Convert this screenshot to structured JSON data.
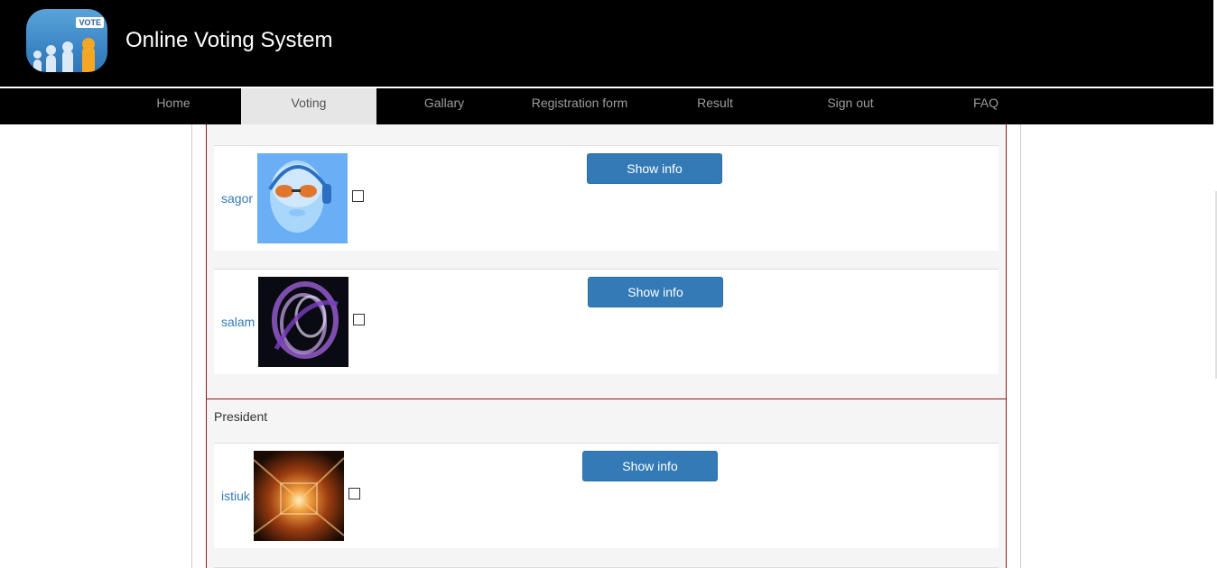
{
  "header": {
    "logo_tag": "VOTE",
    "title": "Online Voting System"
  },
  "nav": {
    "items": [
      {
        "label": "Home"
      },
      {
        "label": "Voting"
      },
      {
        "label": "Gallary"
      },
      {
        "label": "Registration form"
      },
      {
        "label": "Result"
      },
      {
        "label": "Sign out"
      },
      {
        "label": "FAQ"
      }
    ],
    "active": "Voting"
  },
  "sections": [
    {
      "candidates": [
        {
          "name": "sagor",
          "button": "Show info",
          "checked": false,
          "photo": "blue-baby-headphones"
        },
        {
          "name": "salam",
          "button": "Show info",
          "checked": false,
          "photo": "purple-swirl"
        }
      ]
    },
    {
      "title": "President",
      "candidates": [
        {
          "name": "istiuk",
          "button": "Show info",
          "checked": false,
          "photo": "orange-tunnel"
        }
      ]
    }
  ],
  "colors": {
    "header_bg": "#000000",
    "nav_active_bg": "#e6e6e6",
    "button": "#337ab7",
    "link": "#337ab7",
    "section_border": "#8b1a1a"
  }
}
